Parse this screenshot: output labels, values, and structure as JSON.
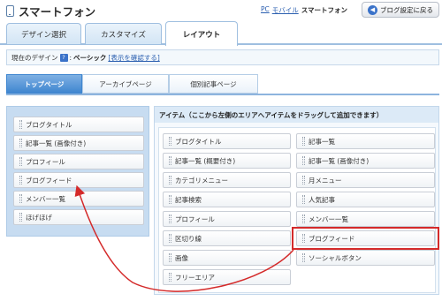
{
  "header": {
    "title": "スマートフォン",
    "device_links": [
      "PC",
      "モバイル"
    ],
    "current_device": "スマートフォン",
    "back_button": "ブログ設定に戻る"
  },
  "tabs": [
    {
      "label": "デザイン選択",
      "active": false
    },
    {
      "label": "カスタマイズ",
      "active": false
    },
    {
      "label": "レイアウト",
      "active": true
    }
  ],
  "current_design": {
    "prefix": "現在のデザイン",
    "help": "?",
    "separator": ":",
    "name": "ベーシック",
    "confirm_link": "[表示を確認する]"
  },
  "subtabs": [
    {
      "label": "トップページ",
      "active": true
    },
    {
      "label": "アーカイブページ",
      "active": false
    },
    {
      "label": "個別記事ページ",
      "active": false
    }
  ],
  "left_items": [
    "ブログタイトル",
    "記事一覧 (画像付き)",
    "プロフィール",
    "ブログフィード",
    "メンバー一覧",
    "ほげほげ"
  ],
  "items_panel": {
    "header": "アイテム（ここから左側のエリアへアイテムをドラッグして追加できます）",
    "col1": [
      "ブログタイトル",
      "記事一覧 (概要付き)",
      "カテゴリメニュー",
      "記事検索",
      "プロフィール",
      "区切り線",
      "画像",
      "フリーエリア"
    ],
    "col2": [
      "記事一覧",
      "記事一覧 (画像付き)",
      "月メニュー",
      "人気記事",
      "メンバー一覧",
      "ブログフィード",
      "ソーシャルボタン"
    ]
  },
  "annotation_color": "#d42a2a"
}
